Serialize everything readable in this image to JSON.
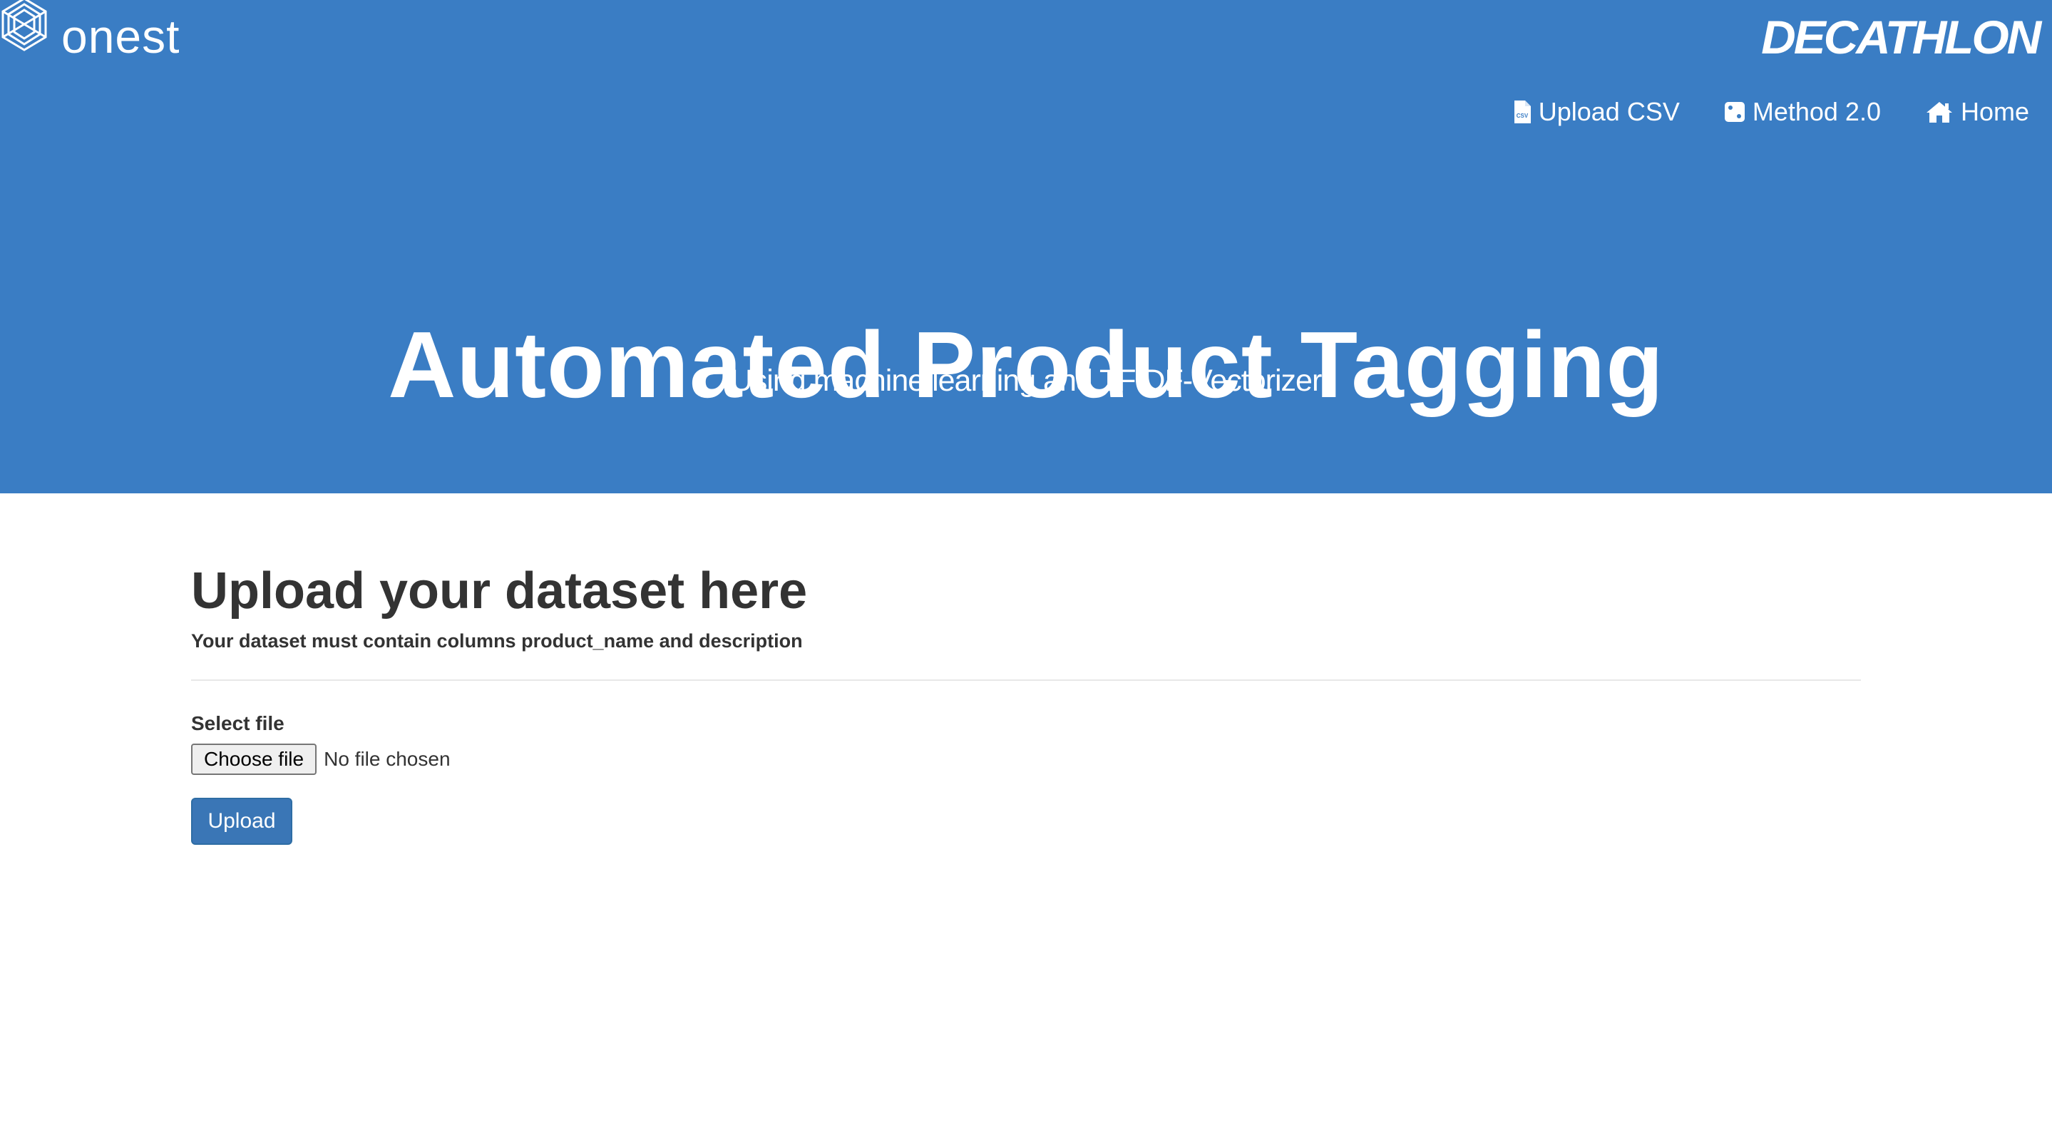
{
  "brand": {
    "left_logo_text": "onest",
    "right_logo_text": "DECATHLON"
  },
  "nav": {
    "items": [
      {
        "label": "Upload CSV",
        "icon": "csv-file-icon"
      },
      {
        "label": "Method 2.0",
        "icon": "dice-icon"
      },
      {
        "label": "Home",
        "icon": "home-icon"
      }
    ]
  },
  "hero": {
    "title": "Automated Product Tagging",
    "subtitle": "Using machine learning and TFIDF-Vectorizer"
  },
  "upload": {
    "heading": "Upload your dataset here",
    "help_text": "Your dataset must contain columns product_name and description",
    "field_label": "Select file",
    "choose_file_label": "Choose file",
    "file_status": "No file chosen",
    "submit_label": "Upload"
  },
  "colors": {
    "hero_background": "#3a7dc4",
    "primary_button": "#3a76b6"
  }
}
